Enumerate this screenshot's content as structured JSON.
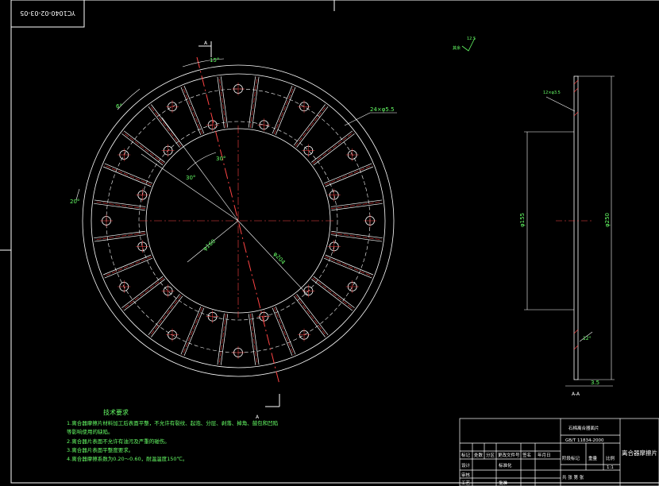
{
  "drawing_number": "YC1040-02-03-05",
  "section_marker": "A",
  "section_view_label": "A-A",
  "surface_finish": {
    "value": "12.5",
    "note": "其余"
  },
  "dimensions": {
    "angle_15": "15°",
    "angle_6": "6°",
    "holes": "24×φ5.5",
    "angle_30_outer": "30°",
    "angle_30_inner": "30°",
    "angle_20": "20°",
    "dia_160": "φ160",
    "dia_204": "φ204",
    "dia_155": "φ155",
    "dia_250": "φ250",
    "thickness": "3.5",
    "side_holes": "12×φ3.5",
    "side_angle": "12°"
  },
  "technical_requirements": {
    "title": "技术要求",
    "items": [
      "1.离合器摩擦片材料加工后表面平整，不允许有裂纹、起泡、分层、剥落、掉角、鼓包和凹陷",
      "  等影响使用的缺陷。",
      "2.离合器片表面不允许有油污及严重的碰伤。",
      "3.离合器片表面平整度要求。",
      "4.离合器摩擦系数为0.20～0.60，耐温温度150℃。"
    ]
  },
  "title_block": {
    "standard_title": "石棉离合器面片",
    "standard_code": "GB/T 11834-2000",
    "part_name": "离合器摩擦片",
    "row_headers": [
      "标记",
      "处数",
      "分区",
      "更改文件号",
      "签名",
      "年月日"
    ],
    "left_rows": [
      "设计",
      "审核",
      "工艺"
    ],
    "standardization": "标准化",
    "approve": "批准",
    "stage_mark": "阶段标记",
    "weight": "重量",
    "scale": "比例",
    "scale_value": "1:1",
    "sheets": "共  张 第  张"
  }
}
